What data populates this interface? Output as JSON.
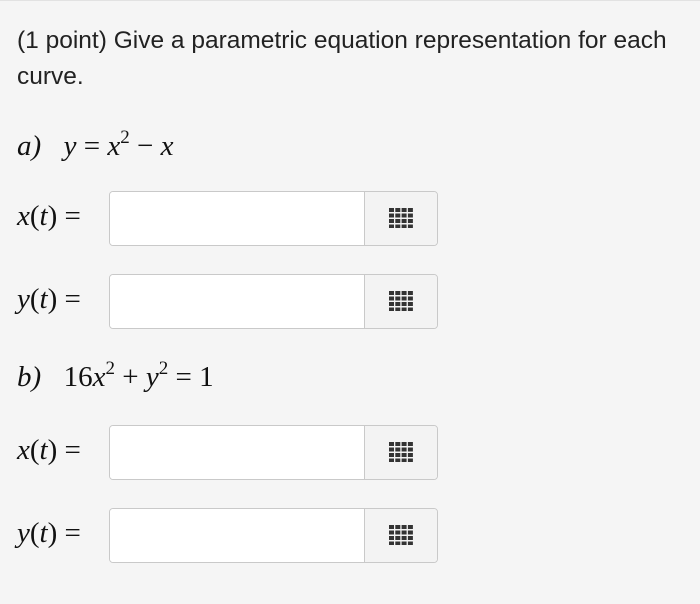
{
  "question": {
    "points": "(1 point)",
    "text": "Give a parametric equation representation for each curve."
  },
  "parts": [
    {
      "label": "a)",
      "equation": "y = x² − x",
      "fields": [
        {
          "label": "x(t) =",
          "value": ""
        },
        {
          "label": "y(t) =",
          "value": ""
        }
      ]
    },
    {
      "label": "b)",
      "equation": "16x² + y² = 1",
      "fields": [
        {
          "label": "x(t) =",
          "value": ""
        },
        {
          "label": "y(t) =",
          "value": ""
        }
      ]
    }
  ],
  "icons": {
    "palette": "equation-editor-grid-icon"
  },
  "colors": {
    "panel_background": "#f5f5f5",
    "input_border": "#c9c9c9",
    "icon": "#333333"
  }
}
